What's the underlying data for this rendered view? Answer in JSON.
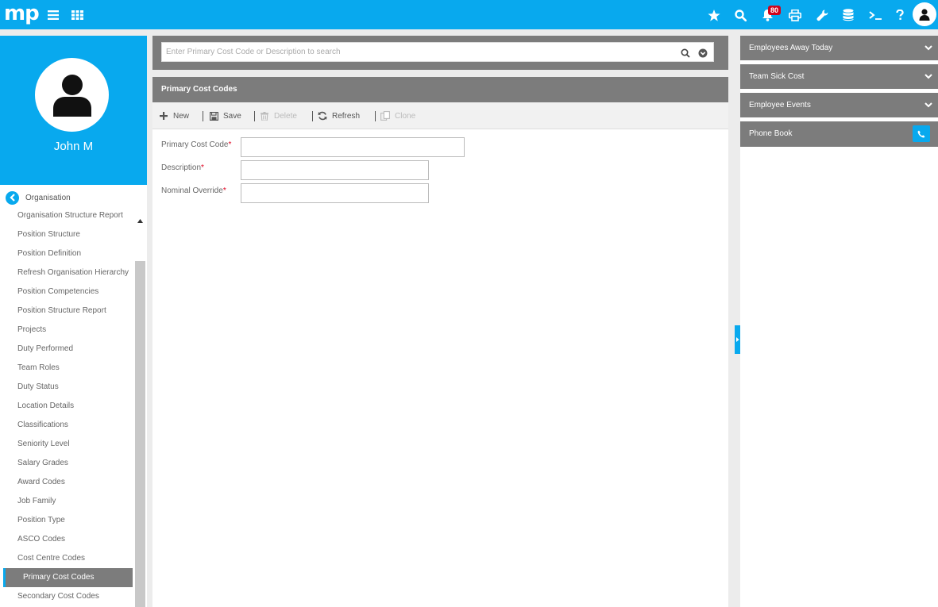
{
  "app": {
    "logo": "mp",
    "notification_count": "80"
  },
  "topbar": {
    "icons": [
      "favourites-star-icon",
      "search-icon",
      "notifications-bell-icon",
      "print-icon",
      "tools-wrench-icon",
      "database-icon",
      "terminal-icon",
      "help-icon",
      "user-avatar-icon"
    ]
  },
  "profile": {
    "name": "John M"
  },
  "nav": {
    "back_label": "Organisation",
    "items": [
      "Organisation Structure Report",
      "Position Structure",
      "Position Definition",
      "Refresh Organisation Hierarchy",
      "Position Competencies",
      "Position Structure Report",
      "Projects",
      "Duty Performed",
      "Team Roles",
      "Duty Status",
      "Location Details",
      "Classifications",
      "Seniority Level",
      "Salary Grades",
      "Award Codes",
      "Job Family",
      "Position Type",
      "ASCO Codes",
      "Cost Centre Codes",
      "Primary Cost Codes",
      "Secondary Cost Codes"
    ],
    "active_index": 19
  },
  "search": {
    "placeholder": "Enter Primary Cost Code or Description to search"
  },
  "card": {
    "title": "Primary Cost Codes"
  },
  "toolbar": {
    "new_label": "New",
    "save_label": "Save",
    "delete_label": "Delete",
    "refresh_label": "Refresh",
    "clone_label": "Clone"
  },
  "form": {
    "primary_cost_code_label": "Primary Cost Code",
    "description_label": "Description",
    "nominal_override_label": "Nominal Override",
    "required_marker": "*",
    "primary_cost_code_value": "",
    "description_value": "",
    "nominal_override_value": ""
  },
  "right_panel": {
    "employees_away_today": "Employees Away Today",
    "team_sick_cost": "Team Sick Cost",
    "employee_events": "Employee Events",
    "phone_book": "Phone Book"
  },
  "colors": {
    "accent": "#08a9ee",
    "panel_header": "#7c7c7c",
    "required": "#e1001f",
    "badge": "#d0021b"
  }
}
